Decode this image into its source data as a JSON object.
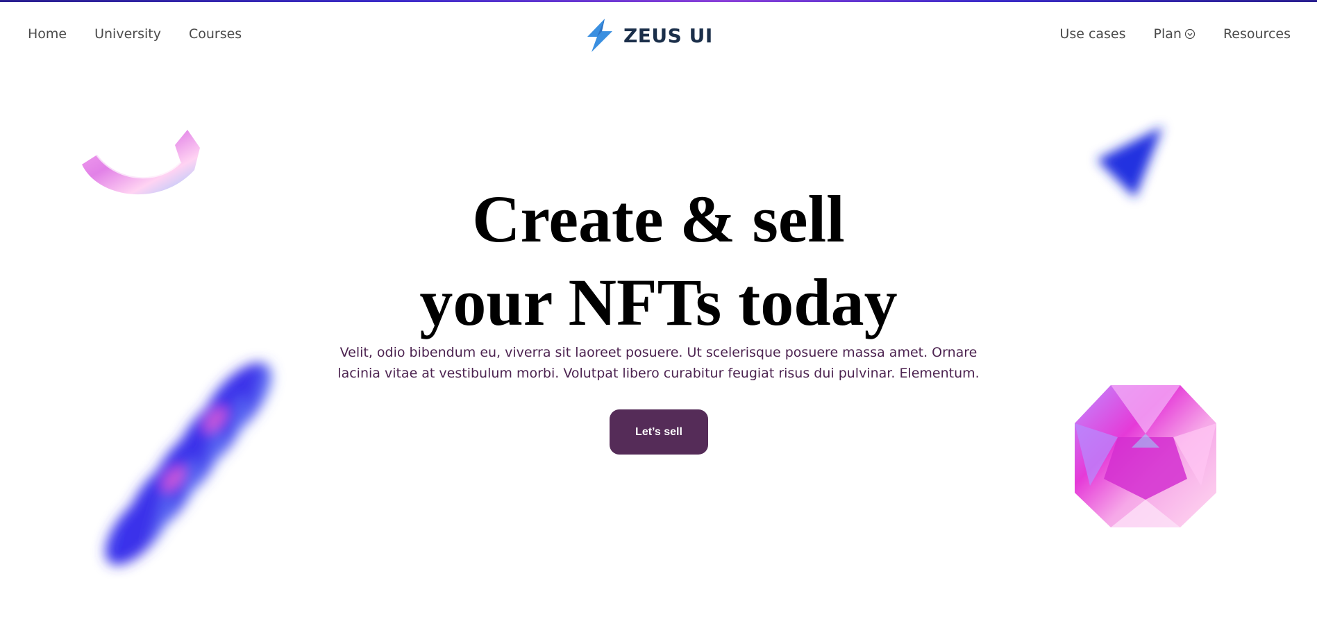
{
  "brand": {
    "name": "ZEUS UI",
    "icon": "lightning-bolt-icon",
    "color": "#1b2f4a",
    "accent": "#3a8fe0"
  },
  "nav": {
    "left": [
      "Home",
      "University",
      "Courses"
    ],
    "right": {
      "use_cases": "Use cases",
      "plan": "Plan",
      "plan_icon": "chevron-down-circle-icon",
      "resources": "Resources"
    }
  },
  "hero": {
    "title_line1": "Create & sell",
    "title_line2": "your NFTs today",
    "description_line1": "Velit, odio bibendum eu, viverra sit laoreet posuere. Ut scelerisque posuere massa amet. Ornare",
    "description_line2": "lacinia vitae at vestibulum morbi. Volutpat libero curabitur feugiat risus dui pulvinar. Elementum.",
    "cta_label": "Let’s sell"
  },
  "colors": {
    "cta_bg": "#552c58",
    "description": "#4c2350",
    "top_line": "#3c2cc9"
  },
  "decorations": [
    "holographic-ring-shape",
    "blurred-blue-cone-shape",
    "blurred-blue-spring-shape",
    "holographic-gem-shape"
  ]
}
